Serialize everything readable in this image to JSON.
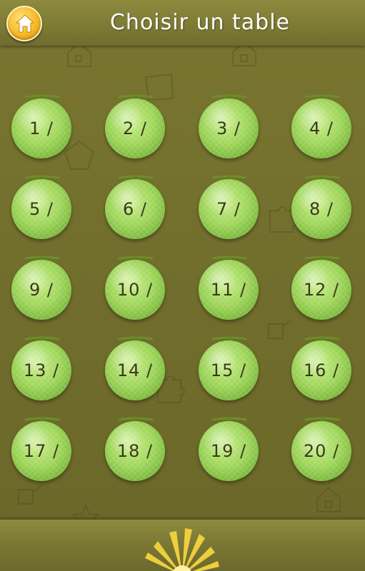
{
  "header": {
    "title": "Choisir un table",
    "home_icon": "home-icon"
  },
  "tables": [
    {
      "label": "1 /"
    },
    {
      "label": "2 /"
    },
    {
      "label": "3 /"
    },
    {
      "label": "4 /"
    },
    {
      "label": "5 /"
    },
    {
      "label": "6 /"
    },
    {
      "label": "7 /"
    },
    {
      "label": "8 /"
    },
    {
      "label": "9 /"
    },
    {
      "label": "10 /"
    },
    {
      "label": "11 /"
    },
    {
      "label": "12 /"
    },
    {
      "label": "13 /"
    },
    {
      "label": "14 /"
    },
    {
      "label": "15 /"
    },
    {
      "label": "16 /"
    },
    {
      "label": "17 /"
    },
    {
      "label": "18 /"
    },
    {
      "label": "19 /"
    },
    {
      "label": "20 /"
    }
  ],
  "footer": {
    "icon": "sunburst-icon"
  },
  "colors": {
    "background": "#716d2c",
    "melon": "#9fd65a",
    "home_button": "#f6b928",
    "title_text": "#ffffff"
  }
}
